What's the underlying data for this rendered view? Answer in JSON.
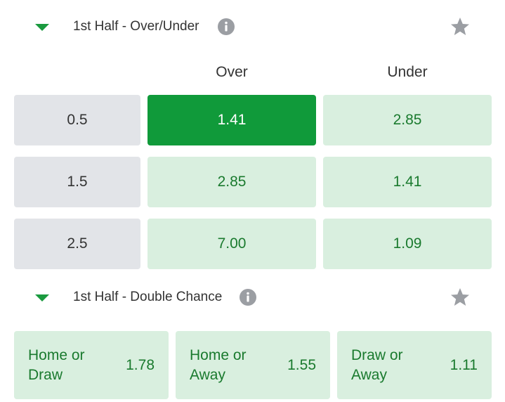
{
  "colors": {
    "accent_green": "#1a9a3f",
    "selected_green": "#109a3a",
    "odd_background": "#d9efdf",
    "odd_text": "#1a7a2e",
    "line_background": "#e2e4e8",
    "icon_gray": "#9b9ea3"
  },
  "over_under": {
    "title": "1st Half - Over/Under",
    "columns": [
      "Over",
      "Under"
    ],
    "rows": [
      {
        "line": "0.5",
        "over": "1.41",
        "under": "2.85",
        "selected": "over"
      },
      {
        "line": "1.5",
        "over": "2.85",
        "under": "1.41",
        "selected": null
      },
      {
        "line": "2.5",
        "over": "7.00",
        "under": "1.09",
        "selected": null
      }
    ]
  },
  "double_chance": {
    "title": "1st Half - Double Chance",
    "options": [
      {
        "label": "Home or\nDraw",
        "odd": "1.78"
      },
      {
        "label": "Home or\nAway",
        "odd": "1.55"
      },
      {
        "label": "Draw or\nAway",
        "odd": "1.11"
      }
    ]
  },
  "icons": {
    "collapse": "caret-down-icon",
    "info": "info-icon",
    "favorite": "star-icon"
  }
}
